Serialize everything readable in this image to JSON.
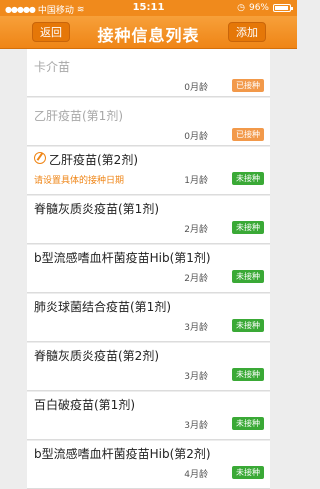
{
  "status_bar": {
    "carrier": "中国移动",
    "time": "15:11",
    "battery": "96%",
    "battery_level": 0.96
  },
  "nav": {
    "title": "接种信息列表",
    "back_label": "返回",
    "add_label": "添加"
  },
  "colors": {
    "accent": "#ef8516",
    "done_badge": "#f2994a",
    "todo_badge": "#3aa936"
  },
  "vaccines": [
    {
      "name": "卡介苗",
      "age": "0月龄",
      "status": "已接种"
    },
    {
      "name": "乙肝疫苗(第1剂)",
      "age": "0月龄",
      "status": "已接种"
    },
    {
      "name": "乙肝疫苗(第2剂)",
      "hint": "请设置具体的接种日期",
      "age": "1月龄",
      "status": "未接种"
    },
    {
      "name": "脊髓灰质炎疫苗(第1剂)",
      "age": "2月龄",
      "status": "未接种"
    },
    {
      "name": "b型流感嗜血杆菌疫苗Hib(第1剂)",
      "age": "2月龄",
      "status": "未接种"
    },
    {
      "name": "肺炎球菌结合疫苗(第1剂)",
      "age": "3月龄",
      "status": "未接种"
    },
    {
      "name": "脊髓灰质炎疫苗(第2剂)",
      "age": "3月龄",
      "status": "未接种"
    },
    {
      "name": "百白破疫苗(第1剂)",
      "age": "3月龄",
      "status": "未接种"
    },
    {
      "name": "b型流感嗜血杆菌疫苗Hib(第2剂)",
      "age": "4月龄",
      "status": "未接种"
    }
  ]
}
